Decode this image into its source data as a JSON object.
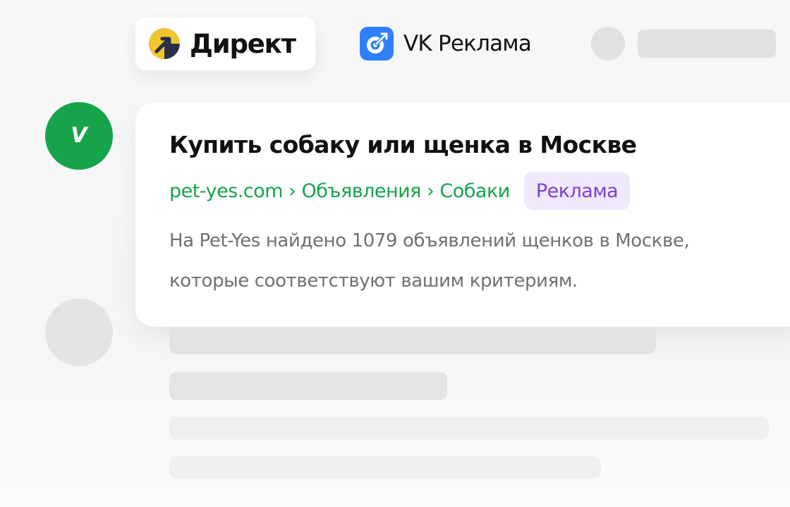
{
  "tabs": {
    "direkt": {
      "label": "Директ",
      "icon": "yandex-direct-icon",
      "icon_bg": "#f3c52c",
      "icon_fg": "#2a2f45",
      "active": true
    },
    "vk": {
      "label": "VK Реклама",
      "icon": "vk-ads-icon",
      "icon_bg": "#2f80ff"
    }
  },
  "result": {
    "avatar_letter": "V",
    "avatar_color": "#16a34a",
    "title": "Купить собаку или щенка в Москве",
    "breadcrumb": "pet-yes.com › Объявления › Собаки",
    "badge": "Реклама",
    "description_line1": "На Pet-Yes найдено 1079 объявлений щенков в Москве,",
    "description_line2": "которые соответствуют вашим критериям."
  },
  "colors": {
    "accent_green": "#16a34a",
    "badge_bg": "#efe9fb",
    "badge_text": "#7c3fd0",
    "placeholder": "#e1e1e3"
  }
}
